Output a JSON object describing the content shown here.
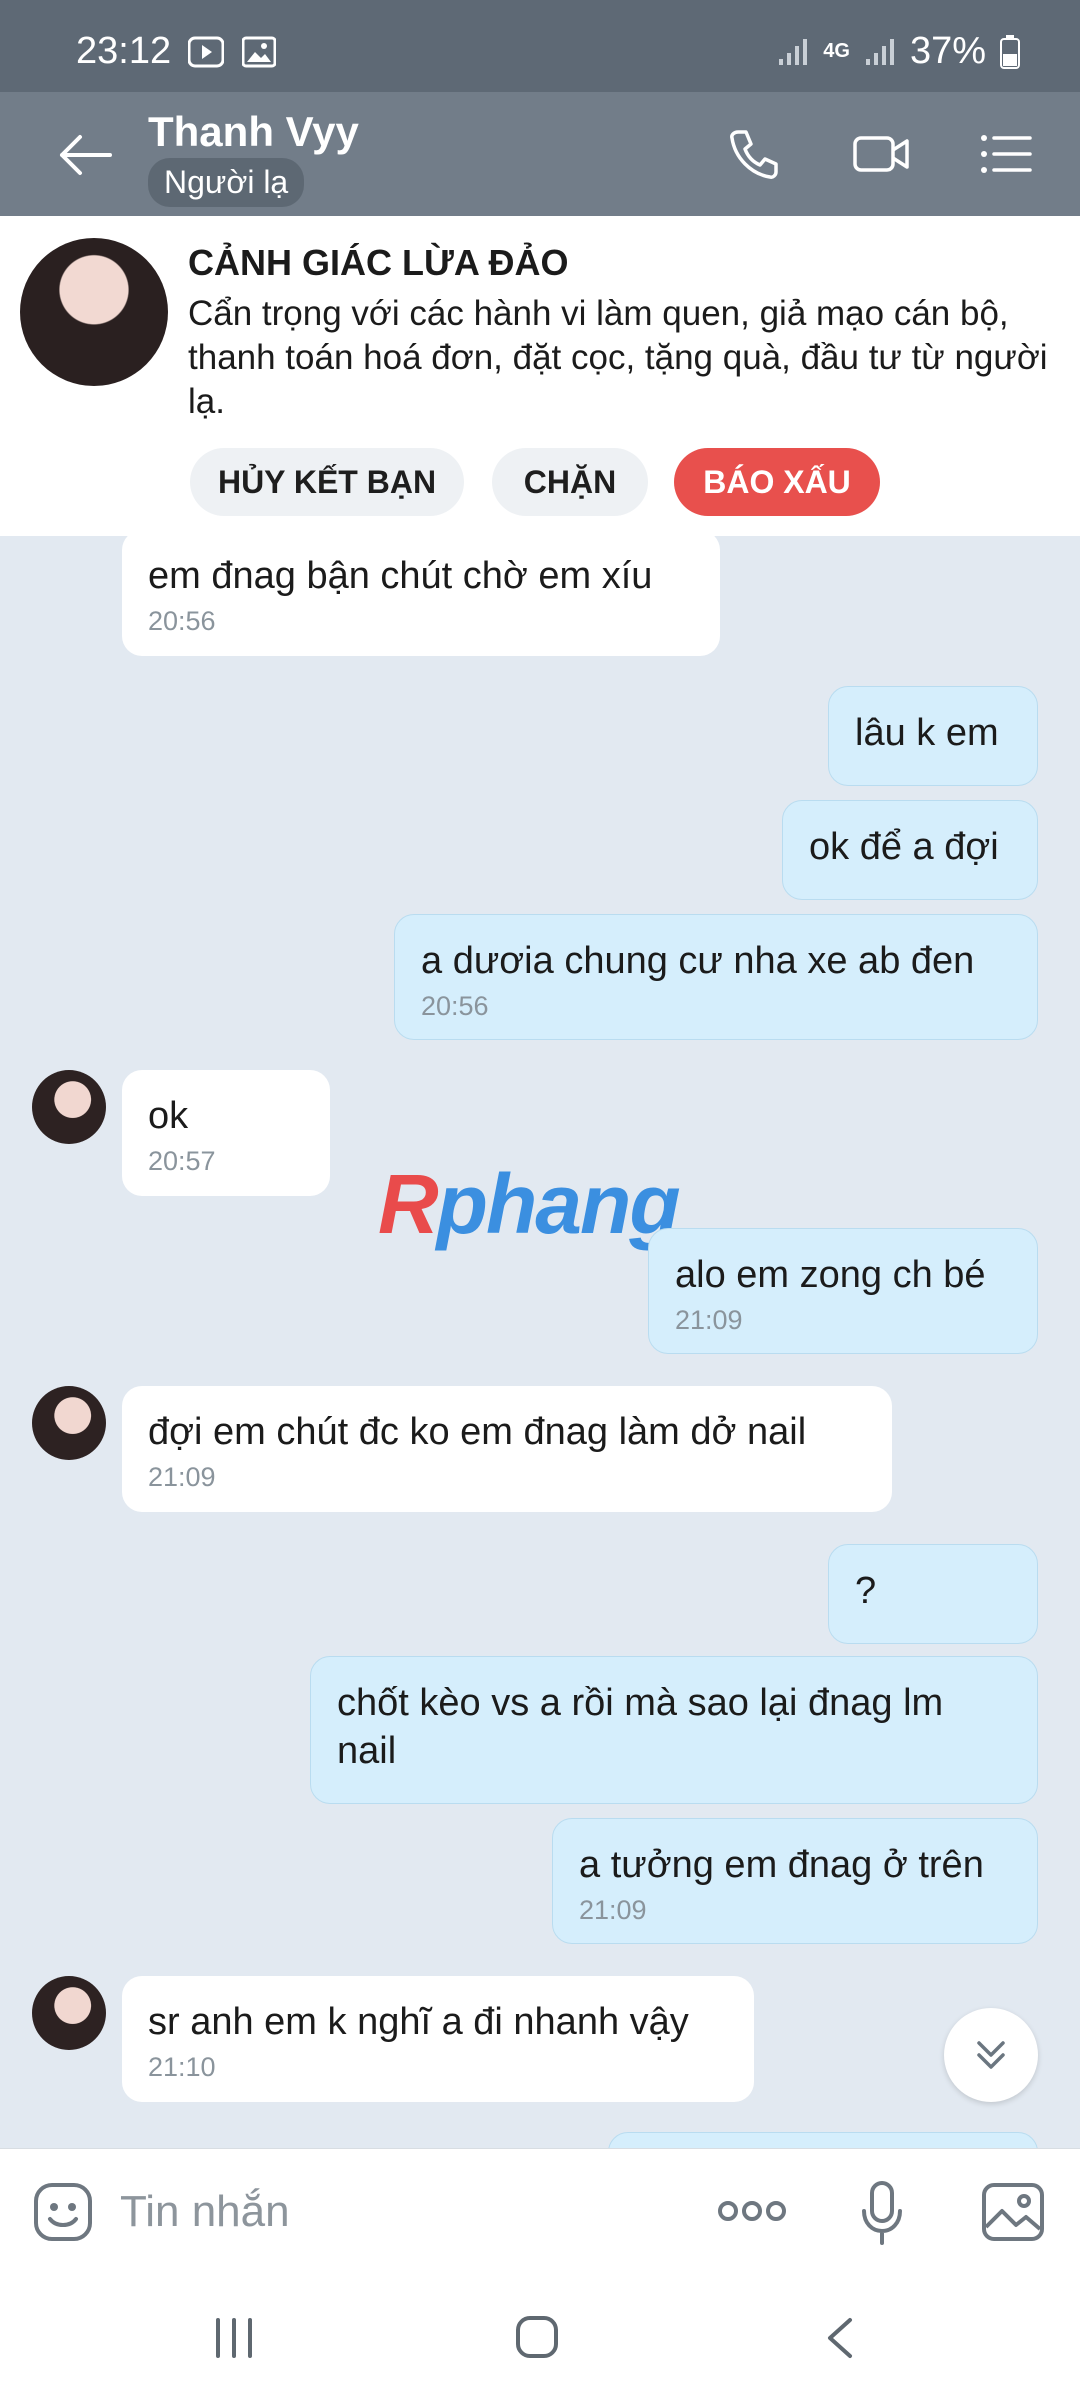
{
  "status_bar": {
    "time": "23:12",
    "network": "4G",
    "battery": "37%"
  },
  "header": {
    "name": "Thanh Vyy",
    "subtitle": "Người lạ",
    "icons": [
      "back-arrow-icon",
      "phone-icon",
      "video-icon",
      "menu-icon"
    ]
  },
  "warning": {
    "title": "CẢNH GIÁC LỪA ĐẢO",
    "text": "Cẩn trọng với các hành vi làm quen, giả mạo cán bộ, thanh toán hoá đơn, đặt cọc, tặng quà, đầu tư từ người lạ.",
    "buttons": {
      "unfriend": "HỦY KẾT BẠN",
      "block": "CHẶN",
      "report": "BÁO XẤU"
    }
  },
  "messages": [
    {
      "dir": "in",
      "text": "em đnag bận chút chờ em xíu",
      "time": "20:56"
    },
    {
      "dir": "out",
      "text": "lâu k em",
      "time": ""
    },
    {
      "dir": "out",
      "text": "ok để a đợi",
      "time": ""
    },
    {
      "dir": "out",
      "text": "a dươia chung cư nha xe ab đen",
      "time": "20:56"
    },
    {
      "dir": "in",
      "text": "ok",
      "time": "20:57"
    },
    {
      "dir": "out",
      "text": "alo em zong ch bé",
      "time": "21:09"
    },
    {
      "dir": "in",
      "text": "đợi em chút đc ko em đnag làm dở nail",
      "time": "21:09"
    },
    {
      "dir": "out",
      "text": "?",
      "time": ""
    },
    {
      "dir": "out",
      "text": "chốt kèo vs a rồi mà sao lại đnag lm nail",
      "time": ""
    },
    {
      "dir": "out",
      "text": "a tưởng em đnag ở trên",
      "time": "21:09"
    },
    {
      "dir": "in",
      "text": "sr anh em k nghĩ a đi nhanh vậy",
      "time": "21:10"
    }
  ],
  "watermark": {
    "first": "R",
    "rest": "phang"
  },
  "input": {
    "placeholder": "Tin nhắn"
  },
  "colors": {
    "header": "#727d89",
    "status_bar": "#5e6975",
    "chat_bg": "#e2e9f1",
    "outgoing": "#d5eefc",
    "incoming": "#ffffff",
    "report": "#e8504d"
  }
}
